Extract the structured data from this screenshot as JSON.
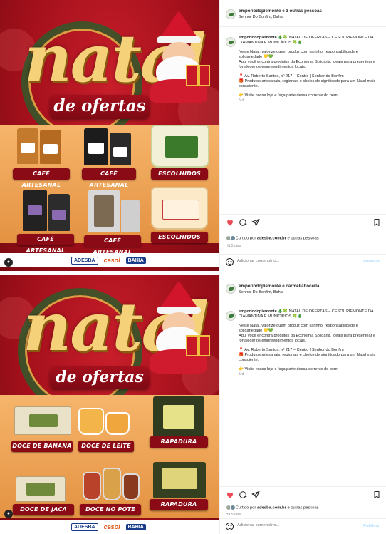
{
  "posts": [
    {
      "header": {
        "user": "emporiodopiemonte e 3 outras pessoas",
        "location": "Senhor Do Bonfim, Bahia",
        "more": "···"
      },
      "caption": {
        "user": "emporiodopiemonte",
        "headline": "🎄🍀 NATAL DE OFERTAS – CESOL PIEMONTE DA DIAMANTINA E MUNICÍPIOS 🍀🎄",
        "para1": "Neste Natal, valorize quem produz com carinho, responsabilidade e solidariedade 💛💚",
        "para2": "Aqui você encontra produtos da Economia Solidária, ideais para presentear e fortalecer os empreendimentos locais.",
        "address": "📍 Av. Roberto Santos, nº 217 – Centro | Senhor do Bonfim",
        "products_line": "🎁 Produtos artesanais, regionais e cheios de significado para um Natal mais consciente.",
        "visit": "👉 Visite nossa loja e faça parte dessa corrente do bem!",
        "time": "5 d"
      },
      "likes": {
        "prefix": "Curtido por",
        "who": "adesba.com.br",
        "suffix": "e outras pessoas"
      },
      "ago": "Há 5 dias",
      "comment": {
        "placeholder": "Adicionar comentário...",
        "publish": "Publicar"
      },
      "image": {
        "title_word": "natal",
        "subtitle": "de ofertas",
        "tags": [
          "CAFÉ ARTESANAL",
          "CAFÉ ARTESANAL",
          "ESCOLHIDOS",
          "CAFÉ ARTESANAL",
          "CAFÉ ARTESANAL",
          "ESCOLHIDOS"
        ],
        "logos": [
          "ADESBA",
          "cesol",
          "BAHIA"
        ]
      }
    },
    {
      "header": {
        "user": "emporiodopiemonte e carmeliabocerla",
        "location": "Senhor Do Bonfim, Bahia",
        "more": "···"
      },
      "caption": {
        "user": "emporiodopiemonte",
        "headline": "🎄🍀 NATAL DE OFERTAS – CESOL PIEMONTE DA DIAMANTINA E MUNICÍPIOS 🍀🎄",
        "para1": "Neste Natal, valorize quem produz com carinho, responsabilidade e solidariedade 💛💚",
        "para2": "Aqui você encontra produtos da Economia Solidária, ideais para presentear e fortalecer os empreendimentos locais.",
        "address": "📍 Av. Roberto Santos, nº 217 – Centro | Senhor do Bonfim",
        "products_line": "🎁 Produtos artesanais, regionais e cheios de significado para um Natal mais consciente.",
        "visit": "👉 Visite nossa loja e faça parte dessa corrente do bem!",
        "time": "5 d"
      },
      "likes": {
        "prefix": "Curtido por",
        "who": "adesba.com.br",
        "suffix": "e outras pessoas"
      },
      "ago": "Há 5 dias",
      "comment": {
        "placeholder": "Adicionar comentário...",
        "publish": "Publicar"
      },
      "image": {
        "title_word": "natal",
        "subtitle": "de ofertas",
        "tags": [
          "DOCE DE BANANA",
          "DOCE DE LEITE",
          "RAPADURA",
          "DOCE DE JACA",
          "DOCE NO POTE",
          "RAPADURA"
        ],
        "logos": [
          "ADESBA",
          "cesol",
          "BAHIA"
        ]
      }
    }
  ],
  "colors": {
    "accent_red": "#a3101b",
    "gold": "#f5d27a",
    "like_red": "#ed4956",
    "link_blue": "#b2dffc"
  }
}
